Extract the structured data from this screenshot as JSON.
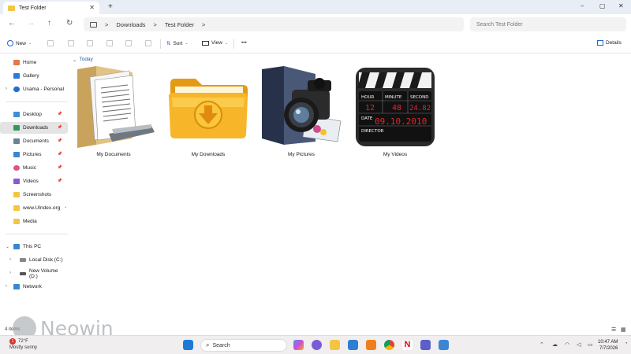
{
  "window": {
    "tab_title": "Test Folder",
    "new_tab": "+",
    "minimize": "–",
    "maximize": "▢",
    "close": "✕"
  },
  "address": {
    "breadcrumb": [
      "Downloads",
      "Test Folder"
    ],
    "separator": ">",
    "search_placeholder": "Search Test Folder"
  },
  "toolbar": {
    "new_label": "New",
    "sort_label": "Sort",
    "view_label": "View",
    "more_label": "•••",
    "details_label": "Details"
  },
  "sidebar": {
    "items": [
      {
        "label": "Home",
        "color": "#e07a4a"
      },
      {
        "label": "Gallery",
        "color": "#2f79d6"
      },
      {
        "label": "Usama - Personal",
        "color": "#1f6fd1"
      },
      {
        "label": "Desktop",
        "color": "#3f8fd8"
      },
      {
        "label": "Downloads",
        "color": "#2e9a5c"
      },
      {
        "label": "Documents",
        "color": "#6d7f99"
      },
      {
        "label": "Pictures",
        "color": "#3a86d4"
      },
      {
        "label": "Music",
        "color": "#e0508a"
      },
      {
        "label": "Videos",
        "color": "#8b57d6"
      },
      {
        "label": "Screenshots",
        "color": "#f4c542"
      },
      {
        "label": "www.UIndex.org",
        "color": "#f4c542"
      },
      {
        "label": "Media",
        "color": "#f4c542"
      },
      {
        "label": "This PC",
        "color": "#3a86d4"
      },
      {
        "label": "Local Disk (C:)",
        "color": "#888888"
      },
      {
        "label": "New Volume (D:)",
        "color": "#555555"
      },
      {
        "label": "Network",
        "color": "#3a86d4"
      }
    ]
  },
  "content": {
    "group_label": "Today",
    "items": [
      {
        "label": "My Documents",
        "icon": "documents-folder-icon"
      },
      {
        "label": "My Downloads",
        "icon": "downloads-folder-icon"
      },
      {
        "label": "My Pictures",
        "icon": "pictures-camera-icon"
      },
      {
        "label": "My Videos",
        "icon": "clapperboard-icon"
      }
    ],
    "clapper": {
      "hour_label": "HOUR",
      "minute_label": "MINUTE",
      "second_label": "SECOND",
      "hour": "12",
      "minute": "48",
      "second": "24.82",
      "date_label": "DATE",
      "date": "09.10.2010",
      "director_label": "DIRECTOR"
    }
  },
  "status": {
    "item_count": "4 items"
  },
  "watermark": {
    "brand": "Neowin"
  },
  "taskbar": {
    "weather_temp": "72°F",
    "weather_desc": "Mostly sunny",
    "weather_alert": "1",
    "search_label": "Search",
    "time": "10:47 AM",
    "date": "7/7/2026"
  }
}
